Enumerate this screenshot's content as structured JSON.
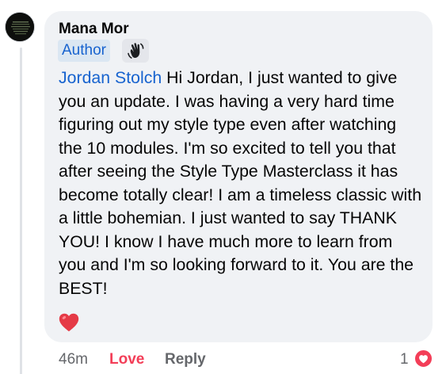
{
  "comment": {
    "author_name": "Mana Mor",
    "author_badge": "Author",
    "mention": "Jordan Stolch",
    "text": " Hi Jordan, I just wanted to give you an update. I was having a very hard time figuring out my style type even after watching the 10 modules. I'm so excited to tell you that after seeing the Style Type Masterclass it has become totally clear! I am a timeless classic with a little bohemian. I just wanted to say THANK YOU! I know I have much more to learn from you and I'm so looking forward to it. You are the BEST!",
    "emoji": "heart"
  },
  "actions": {
    "time": "46m",
    "love_label": "Love",
    "reply_label": "Reply"
  },
  "reactions": {
    "count": "1",
    "type": "love"
  },
  "colors": {
    "bubble": "#f0f2f5",
    "link": "#1763cf",
    "love": "#f33e58",
    "meta": "#65676b"
  }
}
